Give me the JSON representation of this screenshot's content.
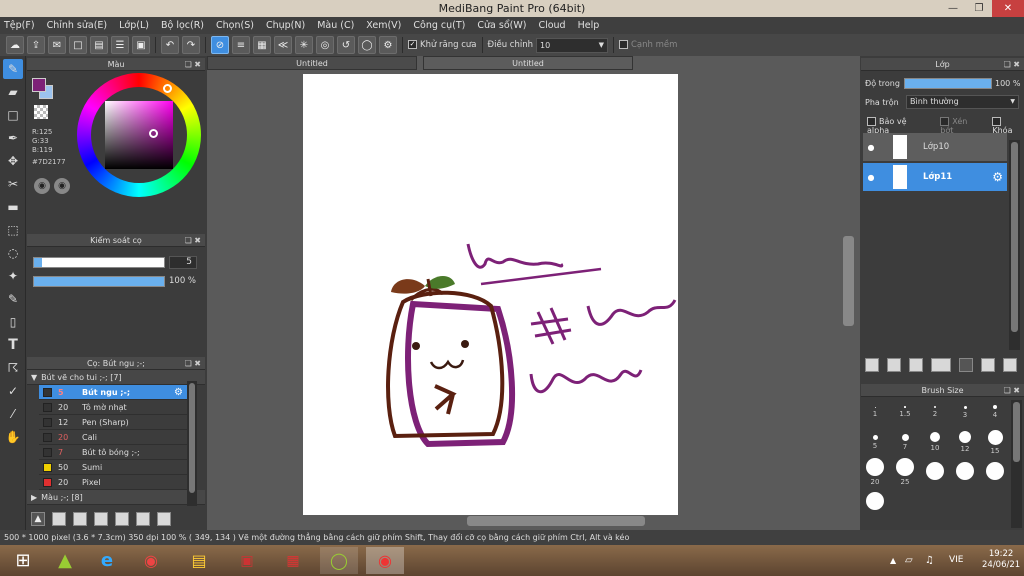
{
  "window": {
    "title": "MediBang Paint Pro (64bit)"
  },
  "menu": [
    "Tệp(F)",
    "Chỉnh sửa(E)",
    "Lớp(L)",
    "Bộ lọc(R)",
    "Chọn(S)",
    "Chụp(N)",
    "Màu (C)",
    "Xem(V)",
    "Công cụ(T)",
    "Cửa sổ(W)",
    "Cloud",
    "Help"
  ],
  "toolbar": {
    "antialias_label": "Khử răng cưa",
    "adjust_label": "Điều chỉnh",
    "adjust_value": "10",
    "edge_label": "Cạnh mềm"
  },
  "color_panel": {
    "title": "Màu",
    "r": "R:125",
    "g": "G:33",
    "b": "B:119",
    "hex": "#7D2177",
    "fg_color": "#7D2177"
  },
  "brush_control": {
    "title": "Kiểm soát cọ",
    "size_value": "5",
    "opacity_value": "100 %",
    "opacity_fraction": 1.0
  },
  "brush_panel": {
    "title": "Cọ: Bút ngu ;-;",
    "group1": "Bút vẽ cho tui ;-; [7]",
    "items": [
      {
        "num": "5",
        "name": "Bút ngu ;-;",
        "color": "#333333",
        "selected": true
      },
      {
        "num": "20",
        "name": "Tô mờ nhạt",
        "color": "#333333",
        "selected": false
      },
      {
        "num": "12",
        "name": "Pen (Sharp)",
        "color": "#333333",
        "selected": false
      },
      {
        "num": "20",
        "name": "Cali",
        "color": "#333333",
        "selected": false
      },
      {
        "num": "7",
        "name": "Bút tô bóng ;-;",
        "color": "#333333",
        "selected": false
      },
      {
        "num": "50",
        "name": "Sumi",
        "color": "#f0d000",
        "selected": false
      },
      {
        "num": "20",
        "name": "Pixel",
        "color": "#e03030",
        "selected": false
      }
    ],
    "group2": "Màu ;-; [8]"
  },
  "tabs": [
    "Untitled",
    "Untitled"
  ],
  "layer_panel": {
    "title": "Lớp",
    "opacity_label": "Độ trong",
    "opacity_value": "100 %",
    "blend_label": "Pha trộn",
    "blend_value": "Bình thường",
    "protect_alpha": "Bảo vệ alpha",
    "clip": "Xén bớt",
    "lock": "Khóa",
    "layers": [
      {
        "name": "Lớp10",
        "selected": false
      },
      {
        "name": "Lớp11",
        "selected": true
      }
    ]
  },
  "brush_size_panel": {
    "title": "Brush Size",
    "sizes": [
      "1",
      "1.5",
      "2",
      "3",
      "4",
      "5",
      "7",
      "10",
      "12",
      "15",
      "20",
      "25",
      "",
      "",
      "",
      ""
    ]
  },
  "status": "500 * 1000 pixel   (3.6 * 7.3cm)   350 dpi   100 %   ( 349, 134 )   Vẽ một đường thẳng bằng cách giữ phím Shift, Thay đổi cỡ cọ bằng cách giữ phím Ctrl, Alt và kéo",
  "taskbar": {
    "lang": "VIE",
    "time": "19:22",
    "date": "24/06/21"
  }
}
